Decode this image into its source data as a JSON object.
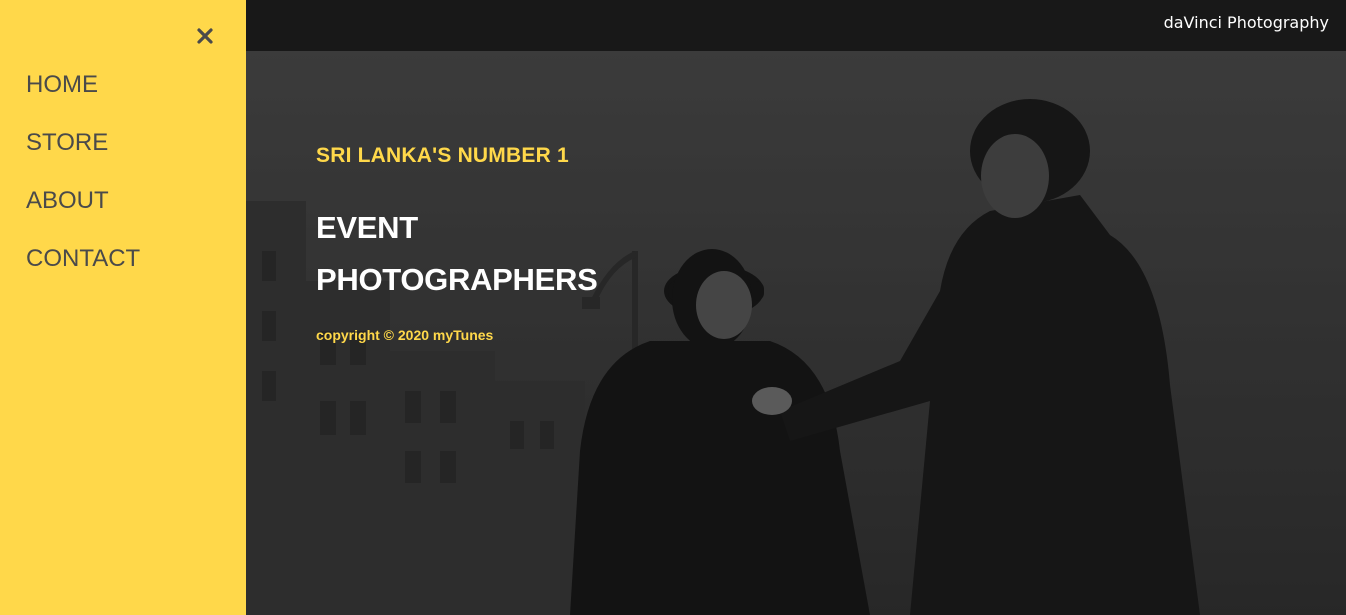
{
  "topbar": {
    "brand": "daVinci Photography"
  },
  "sidebar": {
    "close_icon": "close-icon",
    "items": [
      {
        "label": "HOME"
      },
      {
        "label": "STORE"
      },
      {
        "label": "ABOUT"
      },
      {
        "label": "CONTACT"
      }
    ]
  },
  "hero": {
    "tagline": "SRI LANKA'S NUMBER 1",
    "headline_line1": "EVENT",
    "headline_line2": "PHOTOGRAPHERS",
    "copyright": "copyright © 2020 myTunes"
  },
  "colors": {
    "accent": "#ffd84a",
    "sidebar_text": "#4a4a4a",
    "topbar_bg": "#181818"
  }
}
